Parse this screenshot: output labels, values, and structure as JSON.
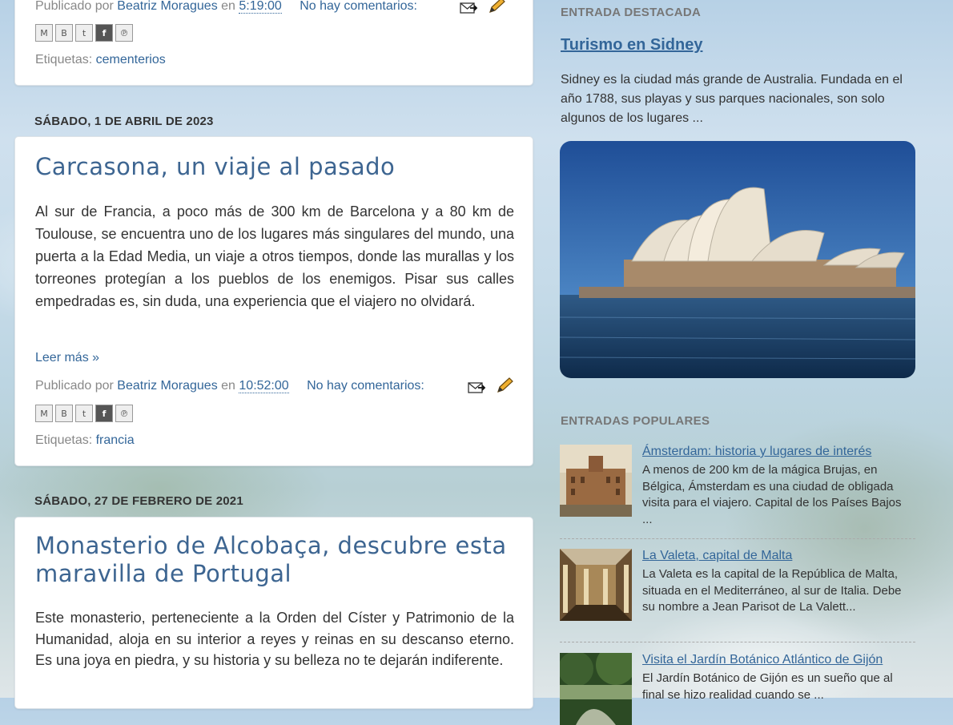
{
  "posts": [
    {
      "meta": {
        "prefix": "Publicado por",
        "author": "Beatriz Moragues",
        "in": "en",
        "time": "5:19:00",
        "comments": "No hay comentarios:"
      },
      "labels": {
        "prefix": "Etiquetas:",
        "tag": "cementerios"
      }
    },
    {
      "date": "SÁBADO, 1 DE ABRIL DE 2023",
      "title": "Carcasona, un viaje al pasado",
      "body": "Al sur de Francia, a poco más de 300 km de Barcelona y a 80 km de Toulouse, se encuentra uno de los lugares más singulares del mundo, una puerta a la Edad Media, un viaje a otros tiempos, donde las murallas y los torreones protegían a los pueblos de los enemigos. Pisar sus calles empedradas es, sin duda, una experiencia que el viajero no olvidará.",
      "read_more": "Leer más »",
      "meta": {
        "prefix": "Publicado por",
        "author": "Beatriz Moragues",
        "in": "en",
        "time": "10:52:00",
        "comments": "No hay comentarios:"
      },
      "labels": {
        "prefix": "Etiquetas:",
        "tag": "francia"
      }
    },
    {
      "date": "SÁBADO, 27 DE FEBRERO DE 2021",
      "title_line1": "Monasterio de Alcobaça, descubre esta",
      "title_line2": "maravilla de Portugal",
      "body": "Este monasterio, perteneciente a la Orden del Císter y Patrimonio de la Humanidad, aloja en su interior a reyes y reinas en su descanso eterno. Es una joya en piedra, y su historia y su belleza no te dejarán indiferente."
    }
  ],
  "share_icons": [
    "email-icon",
    "blogger-icon",
    "twitter-icon",
    "facebook-icon",
    "pinterest-icon"
  ],
  "sidebar": {
    "featured": {
      "heading": "ENTRADA DESTACADA",
      "title": "Turismo en Sidney",
      "text": "Sidney es la ciudad más grande de Australia. Fundada en el año 1788, sus playas y sus parques nacionales, son solo algunos de los lugares ..."
    },
    "popular": {
      "heading": "ENTRADAS POPULARES",
      "items": [
        {
          "title": "Ámsterdam: historia y lugares de interés",
          "snippet": "A menos de 200 km de la mágica Brujas, en Bélgica, Ámsterdam es una ciudad de obligada visita para el viajero. Capital de los Países Bajos ..."
        },
        {
          "title": "La Valeta, capital de Malta",
          "snippet": "La Valeta es la capital de la República de Malta, situada en el Mediterráneo, al sur de Italia. Debe su nombre a Jean Parisot de La Valett..."
        },
        {
          "title": "Visita el Jardín Botánico Atlántico de Gijón",
          "snippet": "El Jardín Botánico de Gijón es un sueño que al final se hizo realidad cuando se ..."
        }
      ]
    }
  },
  "colors": {
    "link": "#336699",
    "title": "#3d6591",
    "text": "#333333",
    "muted": "#888888"
  }
}
